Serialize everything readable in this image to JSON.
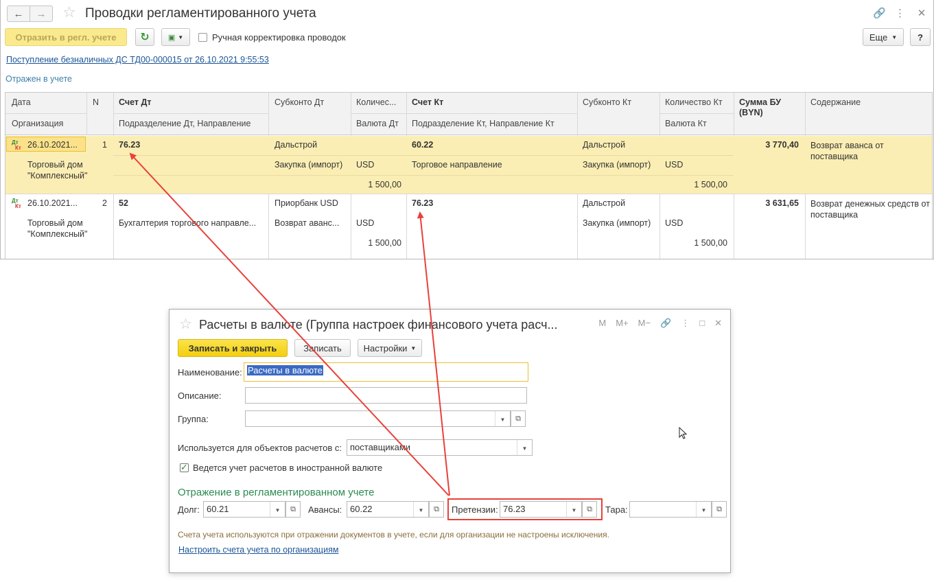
{
  "main": {
    "title": "Проводки регламентированного учета",
    "toolbar": {
      "reflect_label": "Отразить в регл. учете",
      "manual_label": "Ручная корректировка проводок",
      "more_label": "Еще",
      "help_label": "?"
    },
    "doc_link": "Поступление безналичных ДС ТД00-000015 от 26.10.2021 9:55:53",
    "status": "Отражен в учете",
    "columns": {
      "date": "Дата",
      "n": "N",
      "acct_dt": "Счет Дт",
      "subkonto_dt": "Субконто Дт",
      "qty_dt": "Количес...",
      "acct_kt": "Счет Кт",
      "subkonto_kt": "Субконто Кт",
      "qty_kt": "Количество Кт",
      "sum": "Сумма БУ (BYN)",
      "content": "Содержание",
      "org": "Организация",
      "dept_dt": "Подразделение Дт, Направление",
      "cur_dt": "Валюта Дт",
      "dept_kt": "Подразделение Кт, Направление Кт",
      "cur_kt": "Валюта Кт"
    },
    "rows": [
      {
        "icon_dt": "Дт",
        "icon_kt": "Кт",
        "date": "26.10.2021...",
        "n": "1",
        "org": "Торговый дом \"Комплексный\"",
        "acct_dt": "76.23",
        "dept_dt": "",
        "sub_dt_1": "Дальстрой",
        "sub_dt_2": "Закупка (импорт)",
        "sub_dt_3": "",
        "cur_dt": "USD",
        "amt_dt": "1 500,00",
        "acct_kt": "60.22",
        "dept_kt": "Торговое направление",
        "sub_kt_1": "Дальстрой",
        "sub_kt_2": "Закупка (импорт)",
        "cur_kt": "USD",
        "amt_kt": "1 500,00",
        "sum": "3 770,40",
        "content": "Возврат аванса от поставщика"
      },
      {
        "icon_dt": "Дт",
        "icon_kt": "Кт",
        "date": "26.10.2021...",
        "n": "2",
        "org": "Торговый дом \"Комплексный\"",
        "acct_dt": "52",
        "dept_dt": "Бухгалтерия торгового направле...",
        "sub_dt_1": "Приорбанк USD",
        "sub_dt_2": "Возврат аванс...",
        "sub_dt_3": "",
        "cur_dt": "USD",
        "amt_dt": "1 500,00",
        "acct_kt": "76.23",
        "dept_kt": "",
        "sub_kt_1": "Дальстрой",
        "sub_kt_2": "Закупка (импорт)",
        "cur_kt": "USD",
        "amt_kt": "1 500,00",
        "sum": "3 631,65",
        "content": "Возврат денежных средств от поставщика"
      }
    ]
  },
  "dialog": {
    "title": "Расчеты в валюте (Группа настроек финансового учета расч...",
    "icons": [
      "M",
      "M+",
      "M−"
    ],
    "save_close_label": "Записать и закрыть",
    "save_label": "Записать",
    "settings_label": "Настройки",
    "name_label": "Наименование:",
    "name_value": "Расчеты в валюте",
    "desc_label": "Описание:",
    "desc_value": "",
    "group_label": "Группа:",
    "group_value": "",
    "used_for_label": "Используется для объектов расчетов с:",
    "used_for_value": "поставщиками",
    "foreign_currency_label": "Ведется учет расчетов в иностранной валюте",
    "foreign_currency_checked": true,
    "section_title": "Отражение в регламентированном учете",
    "debt_label": "Долг:",
    "debt_value": "60.21",
    "advances_label": "Авансы:",
    "advances_value": "60.22",
    "claims_label": "Претензии:",
    "claims_value": "76.23",
    "tara_label": "Тара:",
    "tara_value": "",
    "note": "Счета учета используются при отражении документов в учете, если для организации не настроены исключения.",
    "configure_link": "Настроить счета учета по организациям"
  },
  "colors": {
    "accent_yellow": "#f3cf0e",
    "selected_row": "#fbeeb4",
    "annotation_red": "#e8403a",
    "section_green": "#2c8a52"
  }
}
